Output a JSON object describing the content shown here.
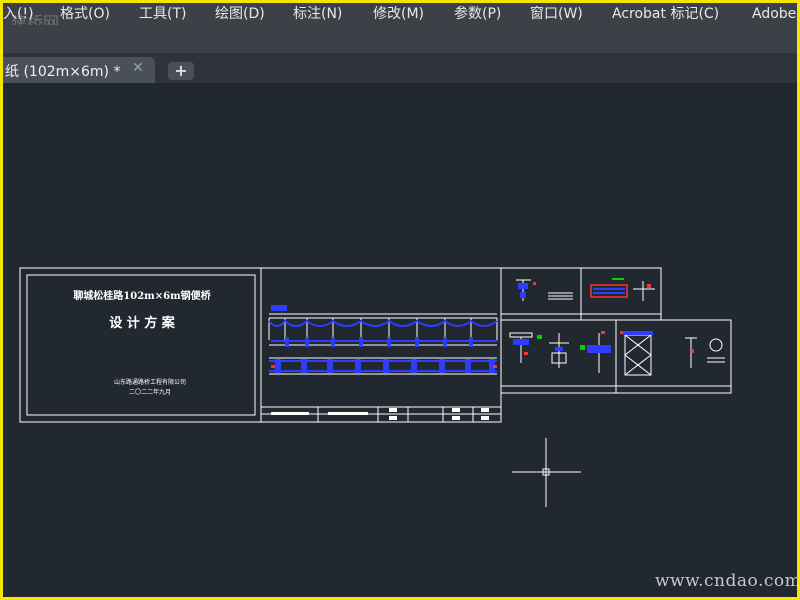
{
  "menubar": {
    "items": [
      "入(!)",
      "格式(O)",
      "工具(T)",
      "绘图(D)",
      "标注(N)",
      "修改(M)",
      "参数(P)",
      "窗口(W)",
      "Acrobat 标记(C)",
      "Adobe"
    ]
  },
  "watermark_top": "建桥网",
  "tab": {
    "label": "纸 (102m×6m)  *",
    "close_glyph": "✕",
    "new_tab_glyph": "+"
  },
  "drawing": {
    "title": "聊城松桂路102m×6m钢便桥",
    "subtitle": "设 计 方 案",
    "company": "山东路通路桥工程有限公司",
    "date": "二〇二二年九月"
  },
  "watermark_bottom": "www.cndao.com",
  "colors": {
    "frame": "#f5e600",
    "background": "#212830",
    "menubar": "#3c4148",
    "line": "#ffffff",
    "accent_blue": "#2d3cff",
    "accent_red": "#ff3030",
    "accent_green": "#00d400"
  }
}
